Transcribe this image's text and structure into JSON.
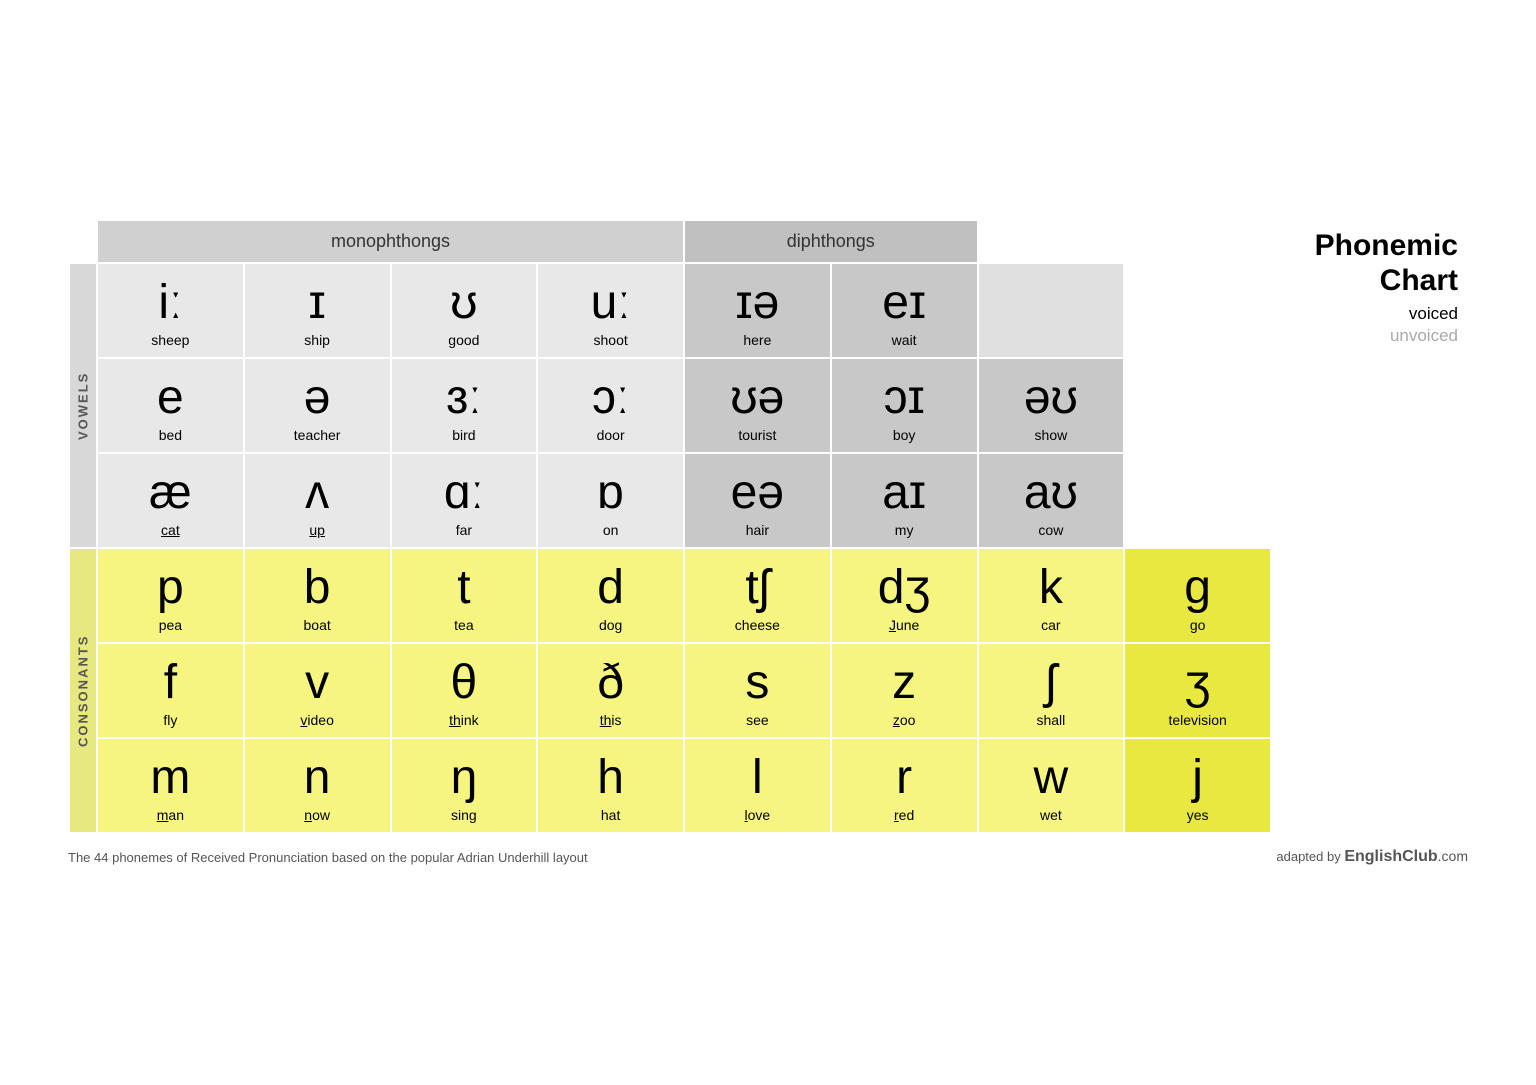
{
  "chart": {
    "title_line1": "Phonemic",
    "title_line2": "Chart",
    "voiced": "voiced",
    "unvoiced": "unvoiced",
    "monophthongs_label": "monophthongs",
    "diphthongs_label": "diphthongs",
    "vowels_label": "VOWELS",
    "consonants_label": "CONSONANTS",
    "footer_text": "The 44 phonemes of Received Pronunciation based on the popular Adrian Underhill layout",
    "adapted_text": "adapted by ",
    "adapted_brand": "EnglishClub",
    "adapted_domain": ".com",
    "vowel_rows": [
      [
        {
          "symbol": "iː",
          "word": "sheep",
          "underline": false
        },
        {
          "symbol": "ɪ",
          "word": "ship",
          "underline": false
        },
        {
          "symbol": "ʊ",
          "word": "good",
          "underline": false
        },
        {
          "symbol": "uː",
          "word": "shoot",
          "underline": false
        },
        {
          "symbol": "ɪə",
          "word": "here",
          "underline": false,
          "diphthong": true
        },
        {
          "symbol": "eɪ",
          "word": "wait",
          "underline": false,
          "diphthong": true
        },
        {
          "symbol": "",
          "word": "",
          "underline": false,
          "empty": true
        }
      ],
      [
        {
          "symbol": "e",
          "word": "bed",
          "underline": false
        },
        {
          "symbol": "ə",
          "word": "teacher",
          "underline": false
        },
        {
          "symbol": "ɜː",
          "word": "bird",
          "underline": false
        },
        {
          "symbol": "ɔː",
          "word": "door",
          "underline": false
        },
        {
          "symbol": "ʊə",
          "word": "tourist",
          "underline": false,
          "diphthong": true
        },
        {
          "symbol": "ɔɪ",
          "word": "boy",
          "underline": false,
          "diphthong": true
        },
        {
          "symbol": "əʊ",
          "word": "show",
          "underline": false,
          "diphthong": true
        }
      ],
      [
        {
          "symbol": "æ",
          "word": "cat",
          "underline": true,
          "cat_under": "c"
        },
        {
          "symbol": "ʌ",
          "word": "up",
          "underline": true
        },
        {
          "symbol": "ɑː",
          "word": "far",
          "underline": false
        },
        {
          "symbol": "ɒ",
          "word": "on",
          "underline": false
        },
        {
          "symbol": "eə",
          "word": "hair",
          "underline": false,
          "diphthong": true
        },
        {
          "symbol": "aɪ",
          "word": "my",
          "underline": false,
          "diphthong": true
        },
        {
          "symbol": "aʊ",
          "word": "cow",
          "underline": false,
          "diphthong": true
        }
      ]
    ],
    "consonant_rows": [
      [
        {
          "symbol": "p",
          "word": "pea",
          "underline": false
        },
        {
          "symbol": "b",
          "word": "boat",
          "underline": false
        },
        {
          "symbol": "t",
          "word": "tea",
          "underline": false
        },
        {
          "symbol": "d",
          "word": "dog",
          "underline": false
        },
        {
          "symbol": "tʃ",
          "word": "cheese",
          "underline": false
        },
        {
          "symbol": "dʒ",
          "word": "June",
          "underline": true,
          "under_char": "J"
        },
        {
          "symbol": "k",
          "word": "car",
          "underline": false
        },
        {
          "symbol": "g",
          "word": "go",
          "underline": false
        }
      ],
      [
        {
          "symbol": "f",
          "word": "fly",
          "underline": false
        },
        {
          "symbol": "v",
          "word": "video",
          "underline": true,
          "under_char": "v"
        },
        {
          "symbol": "θ",
          "word": "think",
          "underline": true,
          "under_char": "th"
        },
        {
          "symbol": "ð",
          "word": "this",
          "underline": true,
          "under_char": "th"
        },
        {
          "symbol": "s",
          "word": "see",
          "underline": false
        },
        {
          "symbol": "z",
          "word": "zoo",
          "underline": true,
          "under_char": "z"
        },
        {
          "symbol": "ʃ",
          "word": "shall",
          "underline": false
        },
        {
          "symbol": "ʒ",
          "word": "television",
          "underline": false
        }
      ],
      [
        {
          "symbol": "m",
          "word": "man",
          "underline": true,
          "under_char": "m"
        },
        {
          "symbol": "n",
          "word": "now",
          "underline": true,
          "under_char": "n"
        },
        {
          "symbol": "ŋ",
          "word": "sing",
          "underline": false
        },
        {
          "symbol": "h",
          "word": "hat",
          "underline": false
        },
        {
          "symbol": "l",
          "word": "love",
          "underline": true,
          "under_char": "l"
        },
        {
          "symbol": "r",
          "word": "red",
          "underline": true,
          "under_char": "r"
        },
        {
          "symbol": "w",
          "word": "wet",
          "underline": false
        },
        {
          "symbol": "j",
          "word": "yes",
          "underline": false
        }
      ]
    ]
  }
}
